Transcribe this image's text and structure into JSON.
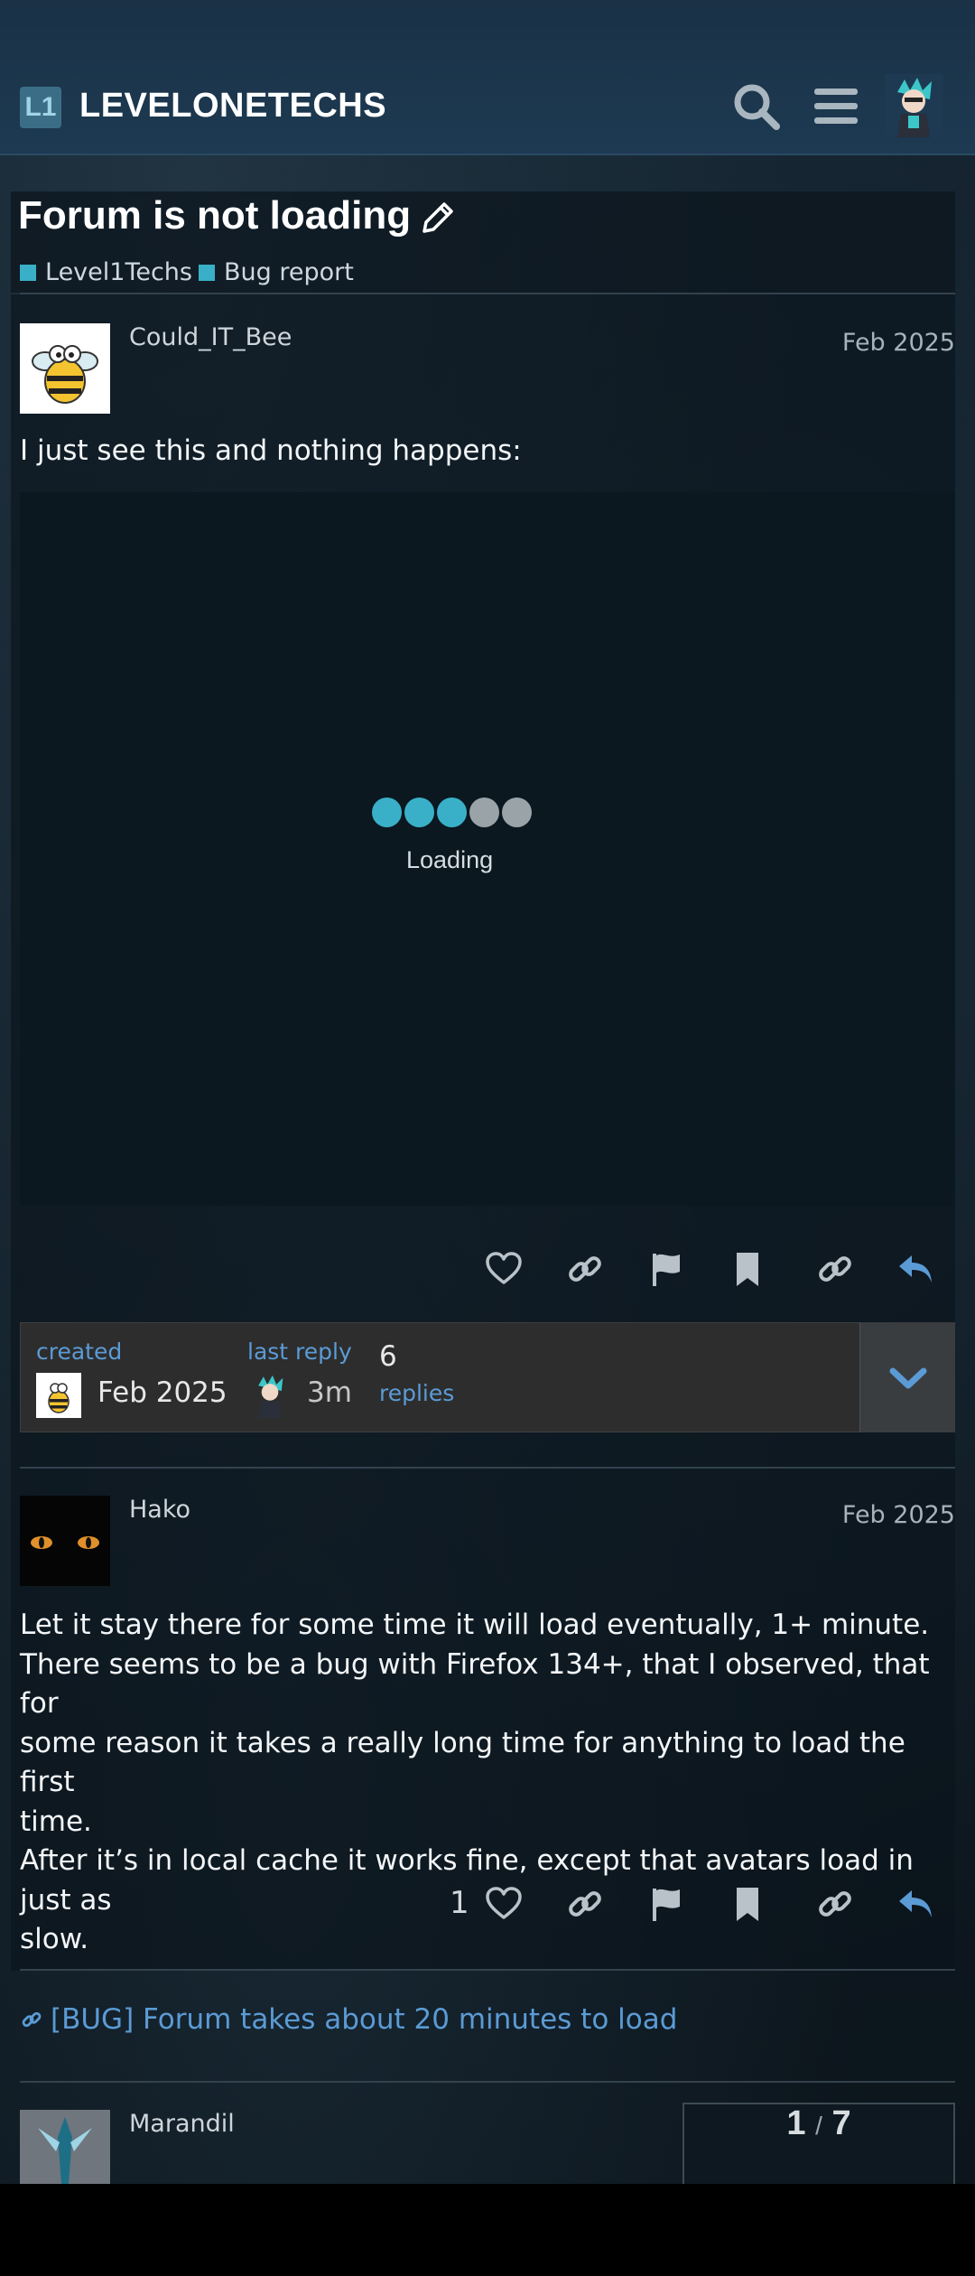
{
  "header": {
    "logo_mark": "L1",
    "site_name": "LEVELONETECHS",
    "icons": [
      "search-icon",
      "hamburger-menu-icon",
      "user-avatar"
    ]
  },
  "topic": {
    "title": "Forum is not loading",
    "categories": [
      {
        "label": "Level1Techs",
        "color": "#3ab0c8"
      },
      {
        "label": "Bug report",
        "color": "#3ab0c8"
      }
    ]
  },
  "posts": [
    {
      "username": "Could_IT_Bee",
      "date": "Feb 2025",
      "text": "I just see this and nothing happens:",
      "embedded_screenshot": {
        "loading_label": "Loading",
        "dot_colors": [
          "#3ab0c8",
          "#3ab0c8",
          "#3ab0c8",
          "#9aa3a8",
          "#9aa3a8"
        ]
      }
    },
    {
      "username": "Hako",
      "date": "Feb 2025",
      "lines": [
        "Let it stay there for some time it will load eventually, 1+ minute.",
        "There seems to be a bug with Firefox 134+, that I observed, that for",
        "some reason it takes a really long time for anything to load the first",
        "time.",
        "After it’s in local cache it works fine, except that avatars load in just as",
        "slow."
      ],
      "like_count": "1"
    },
    {
      "username": "Marandil"
    }
  ],
  "topic_map": {
    "created_label": "created",
    "created_value": "Feb 2025",
    "last_reply_label": "last reply",
    "last_reply_value": "3m",
    "replies_count": "6",
    "replies_label": "replies"
  },
  "linked_topic": "[BUG] Forum takes about 20 minutes to load",
  "progress": {
    "current": "1",
    "separator": "/",
    "total": "7"
  },
  "colors": {
    "accent": "#3ab0c8",
    "link": "#5b9bd5",
    "header_bg": "#1d3a52"
  }
}
